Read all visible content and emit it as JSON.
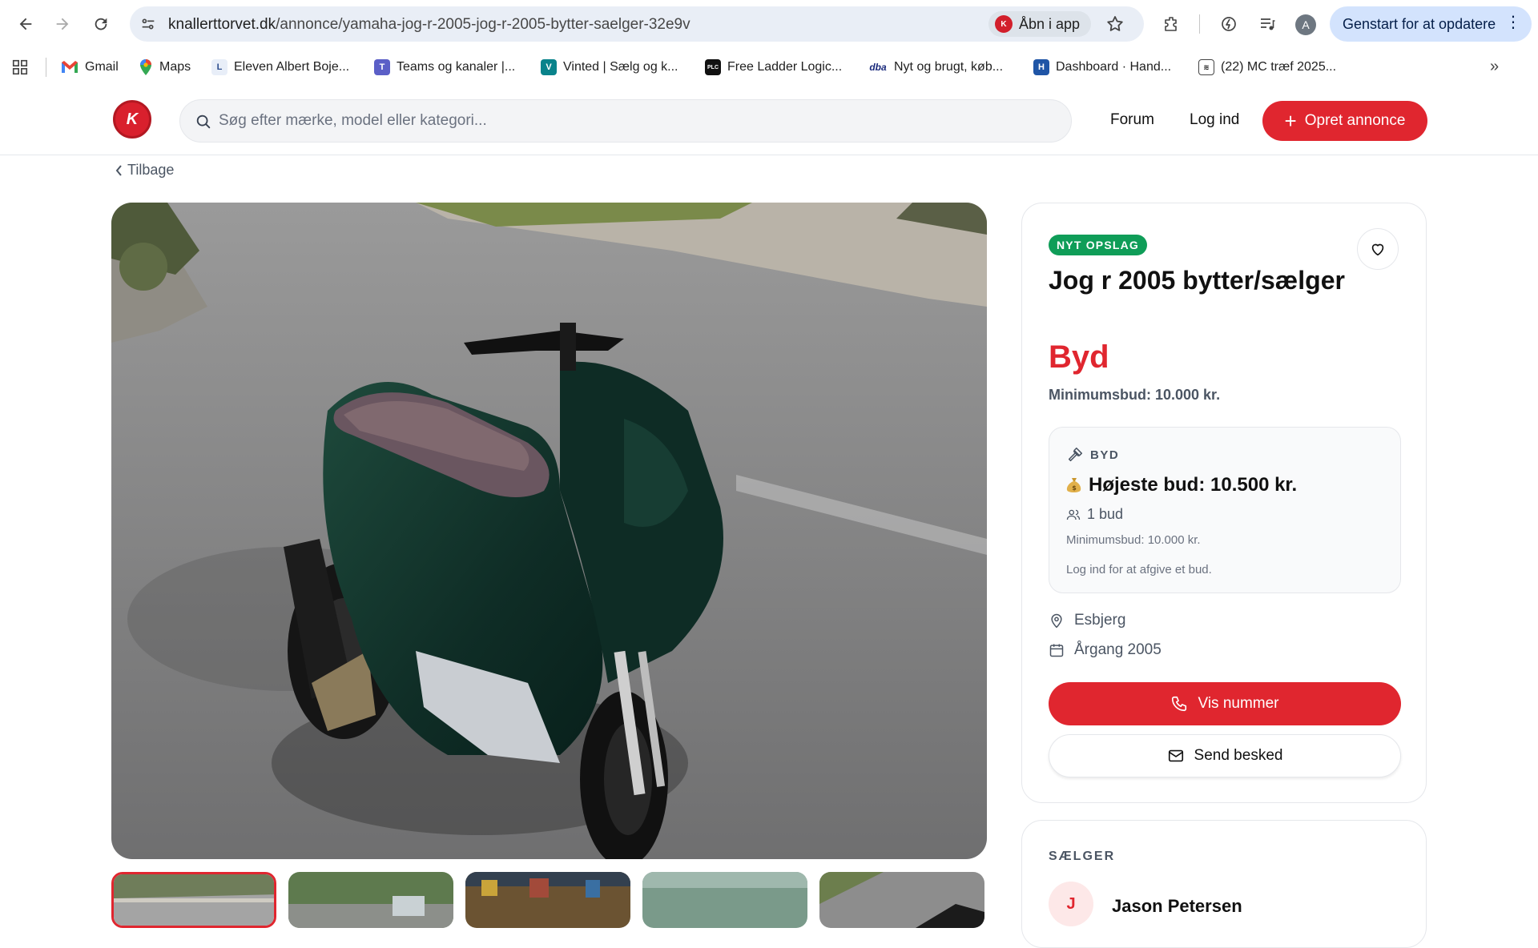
{
  "browser": {
    "url_host": "knallerttorvet.dk",
    "url_path": "/annonce/yamaha-jog-r-2005-jog-r-2005-bytter-saelger-32e9v",
    "open_in_app": "Åbn i app",
    "profile_initial": "A",
    "restart_label": "Genstart for at opdatere"
  },
  "bookmarks": [
    {
      "label": "Gmail"
    },
    {
      "label": "Maps"
    },
    {
      "label": "Eleven Albert Boje..."
    },
    {
      "label": "Teams og kanaler |..."
    },
    {
      "label": "Vinted | Sælg og k..."
    },
    {
      "label": "Free Ladder Logic..."
    },
    {
      "label": "Nyt og brugt, køb..."
    },
    {
      "label": "Dashboard · Hand..."
    },
    {
      "label": "(22) MC træf 2025..."
    }
  ],
  "site": {
    "logo_text": "K",
    "search_placeholder": "Søg efter mærke, model eller kategori...",
    "forum": "Forum",
    "login": "Log ind",
    "create": "Opret annonce",
    "back": "Tilbage"
  },
  "listing": {
    "badge": "NYT OPSLAG",
    "title": "Jog r 2005 bytter/sælger",
    "price": "Byd",
    "min_bid": "Minimumsbud: 10.000 kr.",
    "bid": {
      "label": "BYD",
      "highest": "Højeste bud: 10.500 kr.",
      "count": "1 bud",
      "min": "Minimumsbud: 10.000 kr.",
      "login_note": "Log ind for at afgive et bud."
    },
    "location": "Esbjerg",
    "year": "Årgang 2005",
    "show_number": "Vis nummer",
    "send_message": "Send besked"
  },
  "seller": {
    "label": "SÆLGER",
    "initial": "J",
    "name": "Jason Petersen"
  },
  "colors": {
    "accent": "#e0262f",
    "badge": "#0f9d58"
  }
}
